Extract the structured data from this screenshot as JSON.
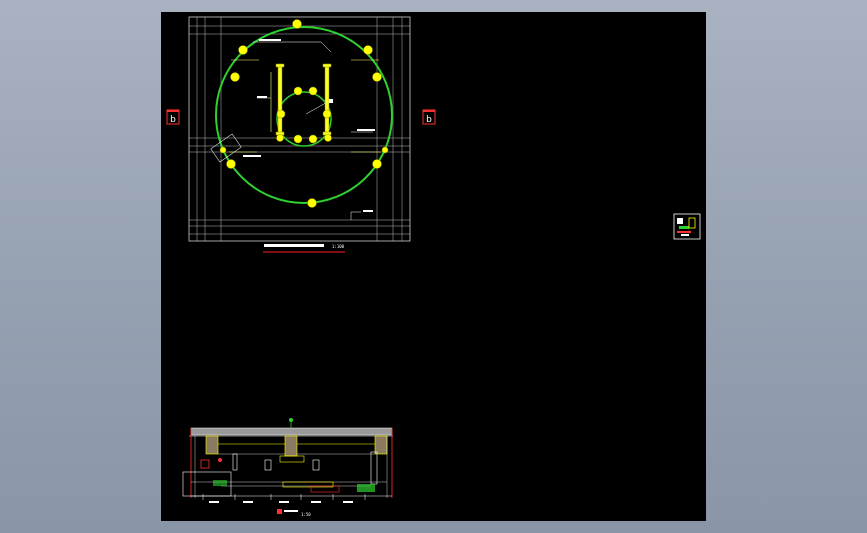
{
  "colors": {
    "background_top": "#a9b2c1",
    "background_bottom": "#8a96a8",
    "sheet": "#000000",
    "circle": "#2fd02f",
    "node": "#ffff00",
    "grid": "#c8c8c8",
    "marker": "#ff2020"
  },
  "plan": {
    "title": "",
    "scale": "1:100",
    "section_marker_left": "b",
    "section_marker_right": "b"
  },
  "section": {
    "title": "",
    "scale": "1:50"
  }
}
